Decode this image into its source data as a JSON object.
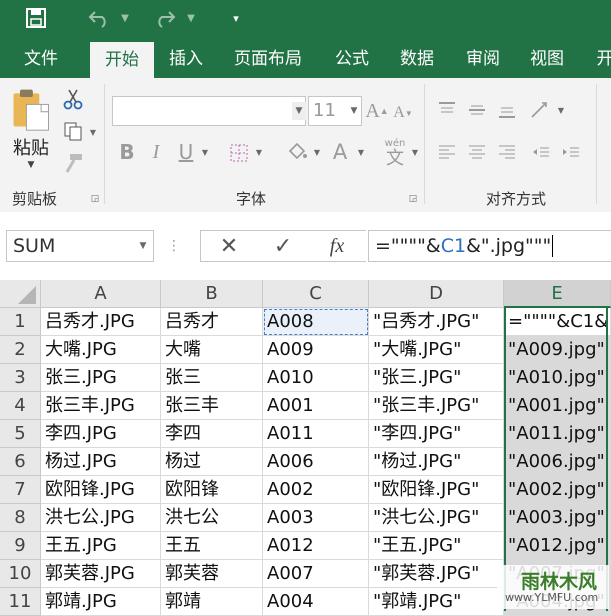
{
  "tabs": [
    "文件",
    "开始",
    "插入",
    "页面布局",
    "公式",
    "数据",
    "审阅",
    "视图",
    "开"
  ],
  "active_tab": "开始",
  "ribbon": {
    "paste_label": "粘贴",
    "font_size": "11",
    "wen_label": "wén",
    "wen_char": "文",
    "groups": [
      "剪贴板",
      "字体",
      "对齐方式"
    ]
  },
  "formula_bar": {
    "name_box": "SUM",
    "formula_prefix": "=\"\"\"\"&",
    "formula_ref": "C1",
    "formula_suffix": "&\".jpg\"\"\""
  },
  "columns": [
    "A",
    "B",
    "C",
    "D",
    "E"
  ],
  "rows": [
    {
      "n": "1",
      "a": "吕秀才.JPG",
      "b": "吕秀才",
      "c": "A008",
      "d": "\"吕秀才.JPG\"",
      "e": "=\"\"\"\"&C1&"
    },
    {
      "n": "2",
      "a": "大嘴.JPG",
      "b": "大嘴",
      "c": "A009",
      "d": "\"大嘴.JPG\"",
      "e": "\"A009.jpg\""
    },
    {
      "n": "3",
      "a": "张三.JPG",
      "b": "张三",
      "c": "A010",
      "d": "\"张三.JPG\"",
      "e": "\"A010.jpg\""
    },
    {
      "n": "4",
      "a": "张三丰.JPG",
      "b": "张三丰",
      "c": "A001",
      "d": "\"张三丰.JPG\"",
      "e": "\"A001.jpg\""
    },
    {
      "n": "5",
      "a": "李四.JPG",
      "b": "李四",
      "c": "A011",
      "d": "\"李四.JPG\"",
      "e": "\"A011.jpg\""
    },
    {
      "n": "6",
      "a": "杨过.JPG",
      "b": "杨过",
      "c": "A006",
      "d": "\"杨过.JPG\"",
      "e": "\"A006.jpg\""
    },
    {
      "n": "7",
      "a": "欧阳锋.JPG",
      "b": "欧阳锋",
      "c": "A002",
      "d": "\"欧阳锋.JPG\"",
      "e": "\"A002.jpg\""
    },
    {
      "n": "8",
      "a": "洪七公.JPG",
      "b": "洪七公",
      "c": "A003",
      "d": "\"洪七公.JPG\"",
      "e": "\"A003.jpg\""
    },
    {
      "n": "9",
      "a": "王五.JPG",
      "b": "王五",
      "c": "A012",
      "d": "\"王五.JPG\"",
      "e": "\"A012.jpg\""
    },
    {
      "n": "10",
      "a": "郭芙蓉.JPG",
      "b": "郭芙蓉",
      "c": "A007",
      "d": "\"郭芙蓉.JPG\"",
      "e": "\"A007.jpg\""
    },
    {
      "n": "11",
      "a": "郭靖.JPG",
      "b": "郭靖",
      "c": "A004",
      "d": "\"郭靖.JPG\"",
      "e": "\"A004.jpg\""
    }
  ],
  "watermark": {
    "title": "雨林木风",
    "url": "www.YLMFU.com"
  },
  "colors": {
    "excel_green": "#217346",
    "ref_blue": "#2f6fbf"
  }
}
